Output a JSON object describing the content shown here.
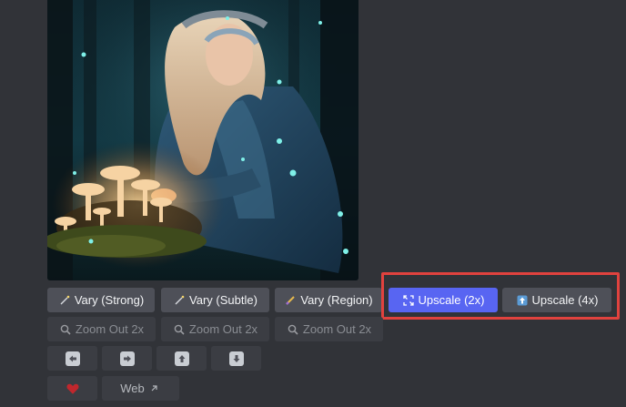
{
  "image": {
    "alt": "generated-artwork"
  },
  "row1": {
    "vary_strong": {
      "label": "Vary (Strong)",
      "icon": "magic-wand-icon"
    },
    "vary_subtle": {
      "label": "Vary (Subtle)",
      "icon": "magic-wand-icon"
    },
    "vary_region": {
      "label": "Vary (Region)",
      "icon": "brush-icon"
    },
    "upscale_2x": {
      "label": "Upscale (2x)",
      "icon": "expand-icon",
      "active": true
    },
    "upscale_4x": {
      "label": "Upscale (4x)",
      "icon": "upscale-icon"
    }
  },
  "row2": {
    "zoom_out_1": {
      "label": "Zoom Out 2x",
      "icon": "magnifier-icon"
    },
    "zoom_out_2": {
      "label": "Zoom Out 2x",
      "icon": "magnifier-icon"
    },
    "zoom_out_3": {
      "label": "Zoom Out 2x",
      "icon": "magnifier-icon"
    }
  },
  "row3": {
    "pan_left": {
      "icon": "arrow-left-icon"
    },
    "pan_right": {
      "icon": "arrow-right-icon"
    },
    "pan_up": {
      "icon": "arrow-up-icon"
    },
    "pan_down": {
      "icon": "arrow-down-icon"
    }
  },
  "row4": {
    "favorite": {
      "icon": "heart-icon"
    },
    "web": {
      "label": "Web",
      "icon": "external-link-icon"
    }
  },
  "colors": {
    "background": "#313338",
    "button": "#4e5058",
    "button_disabled": "#3b3d43",
    "primary": "#5865f2",
    "highlight": "#e0423e",
    "heart": "#c0272d"
  }
}
